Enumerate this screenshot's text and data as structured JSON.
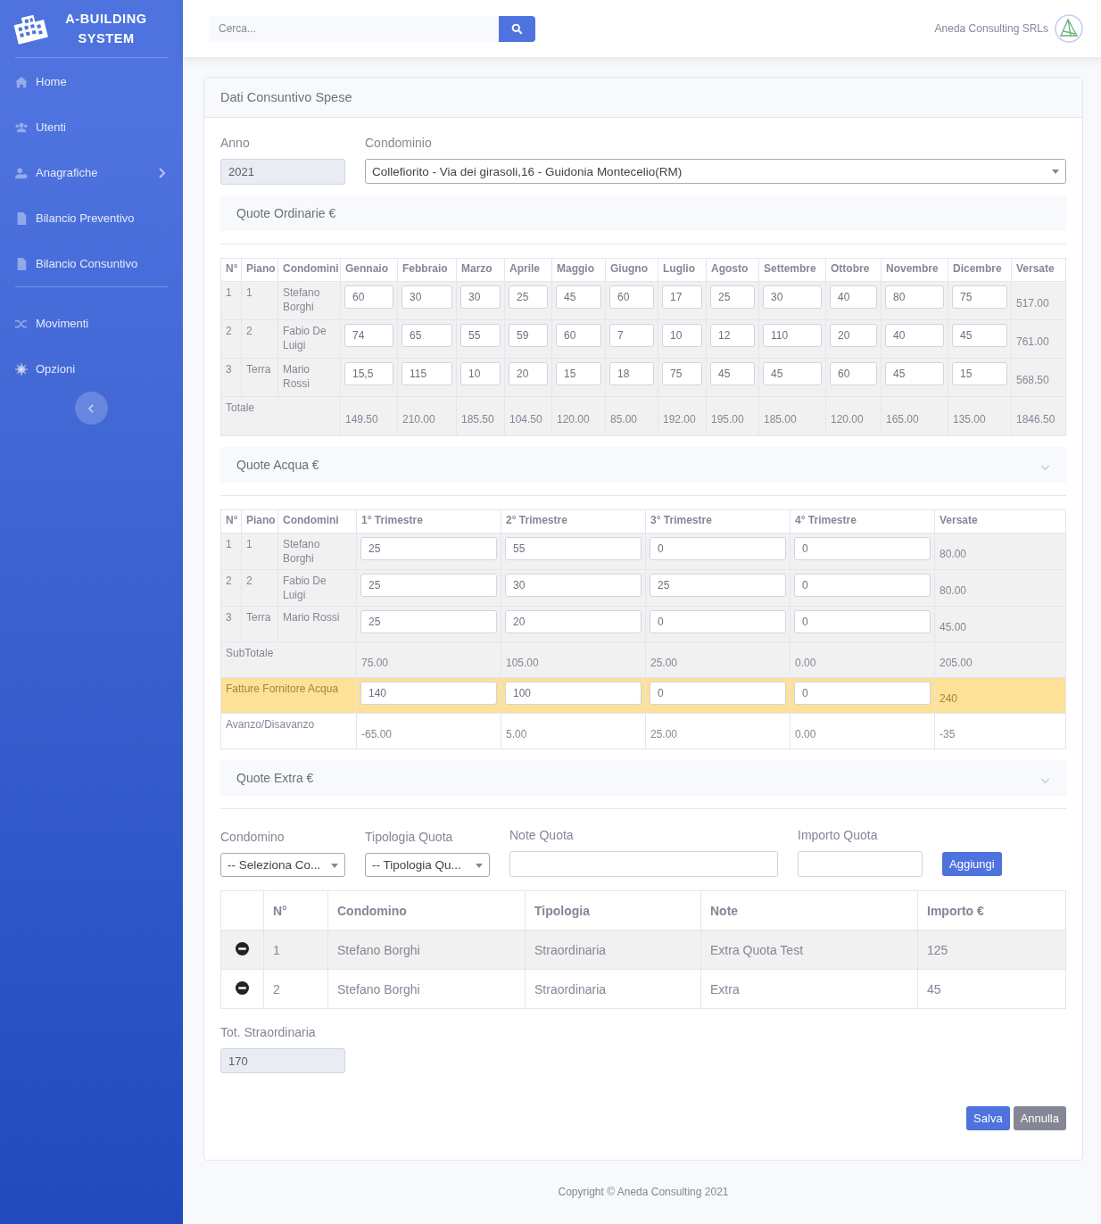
{
  "sidebar": {
    "brand": "A-BUILDING SYSTEM",
    "groups": [
      [
        {
          "label": "Home",
          "kind": "home",
          "expandable": false
        },
        {
          "label": "Utenti",
          "kind": "users",
          "expandable": false
        },
        {
          "label": "Anagrafiche",
          "kind": "user-gear",
          "expandable": true
        },
        {
          "label": "Bilancio Preventivo",
          "kind": "file",
          "expandable": false
        },
        {
          "label": "Bilancio Consuntivo",
          "kind": "file",
          "expandable": false
        }
      ],
      [
        {
          "label": "Movimenti",
          "kind": "shuffle",
          "expandable": false
        },
        {
          "label": "Opzioni",
          "kind": "gear",
          "expandable": false
        }
      ]
    ]
  },
  "topbar": {
    "search": {
      "placeholder": "Cerca..."
    },
    "user": "Aneda Consulting SRLs"
  },
  "card": {
    "title": "Dati Consuntivo Spese",
    "anno": {
      "label": "Anno",
      "value": "2021"
    },
    "condominio": {
      "label": "Condominio",
      "value": "Collefiorito - Via dei girasoli,16 - Guidonia Montecelio(RM)"
    },
    "ordinarie": {
      "title": "Quote Ordinarie €",
      "collapsible": false,
      "columns": [
        "N°",
        "Piano",
        "Condomini",
        "Gennaio",
        "Febbraio",
        "Marzo",
        "Aprile",
        "Maggio",
        "Giugno",
        "Luglio",
        "Agosto",
        "Settembre",
        "Ottobre",
        "Novembre",
        "Dicembre",
        "Versate"
      ],
      "rows": [
        {
          "n": "1",
          "piano": "1",
          "condomino": "Stefano Borghi",
          "values": [
            "60",
            "30",
            "30",
            "25",
            "45",
            "60",
            "17",
            "25",
            "30",
            "40",
            "80",
            "75"
          ],
          "versate": "517.00"
        },
        {
          "n": "2",
          "piano": "2",
          "condomino": "Fabio De Luigi",
          "values": [
            "74",
            "65",
            "55",
            "59",
            "60",
            "7",
            "10",
            "12",
            "110",
            "20",
            "40",
            "45"
          ],
          "versate": "761.00"
        },
        {
          "n": "3",
          "piano": "Terra",
          "condomino": "Mario Rossi",
          "values": [
            "15,5",
            "115",
            "10",
            "20",
            "15",
            "18",
            "75",
            "45",
            "45",
            "60",
            "45",
            "15"
          ],
          "versate": "568.50"
        }
      ],
      "total": {
        "label": "Totale",
        "values": [
          "149.50",
          "210.00",
          "185.50",
          "104.50",
          "120.00",
          "85.00",
          "192.00",
          "195.00",
          "185.00",
          "120.00",
          "165.00",
          "135.00"
        ],
        "versate": "1846.50"
      }
    },
    "acqua": {
      "title": "Quote Acqua €",
      "collapsible": true,
      "columns": [
        "N°",
        "Piano",
        "Condomini",
        "1° Trimestre",
        "2° Trimestre",
        "3° Trimestre",
        "4° Trimestre",
        "Versate"
      ],
      "rows": [
        {
          "n": "1",
          "piano": "1",
          "condomino": "Stefano Borghi",
          "values": [
            "25",
            "55",
            "0",
            "0"
          ],
          "versate": "80.00"
        },
        {
          "n": "2",
          "piano": "2",
          "condomino": "Fabio De Luigi",
          "values": [
            "25",
            "30",
            "25",
            "0"
          ],
          "versate": "80.00"
        },
        {
          "n": "3",
          "piano": "Terra",
          "condomino": "Mario Rossi",
          "values": [
            "25",
            "20",
            "0",
            "0"
          ],
          "versate": "45.00"
        }
      ],
      "subtotal": {
        "label": "SubTotale",
        "values": [
          "75.00",
          "105.00",
          "25.00",
          "0.00"
        ],
        "versate": "205.00"
      },
      "fatture": {
        "label": "Fatture Fornitore Acqua",
        "values": [
          "140",
          "100",
          "0",
          "0"
        ],
        "versate": "240"
      },
      "avanzo": {
        "label": "Avanzo/Disavanzo",
        "values": [
          "-65.00",
          "5.00",
          "25.00",
          "0.00"
        ],
        "versate": "-35"
      }
    },
    "extra": {
      "title": "Quote Extra €",
      "collapsible": true,
      "form": {
        "condomino": {
          "label": "Condomino",
          "value": "-- Seleziona Co..."
        },
        "tipologia": {
          "label": "Tipologia Quota",
          "value": "-- Tipologia Qu..."
        },
        "note": {
          "label": "Note Quota"
        },
        "importo": {
          "label": "Importo Quota"
        },
        "add_button": "Aggiungi"
      },
      "columns": [
        "N°",
        "Condomino",
        "Tipologia",
        "Note",
        "Importo €"
      ],
      "rows": [
        {
          "n": "1",
          "condomino": "Stefano Borghi",
          "tipologia": "Straordinaria",
          "note": "Extra Quota Test",
          "importo": "125"
        },
        {
          "n": "2",
          "condomino": "Stefano Borghi",
          "tipologia": "Straordinaria",
          "note": "Extra",
          "importo": "45"
        }
      ],
      "total": {
        "label": "Tot. Straordinaria",
        "value": "170"
      }
    },
    "buttons": [
      {
        "label": "Salva",
        "kind": "primary"
      },
      {
        "label": "Annulla",
        "kind": "secondary"
      }
    ]
  },
  "footer": "Copyright © Aneda Consulting 2021"
}
